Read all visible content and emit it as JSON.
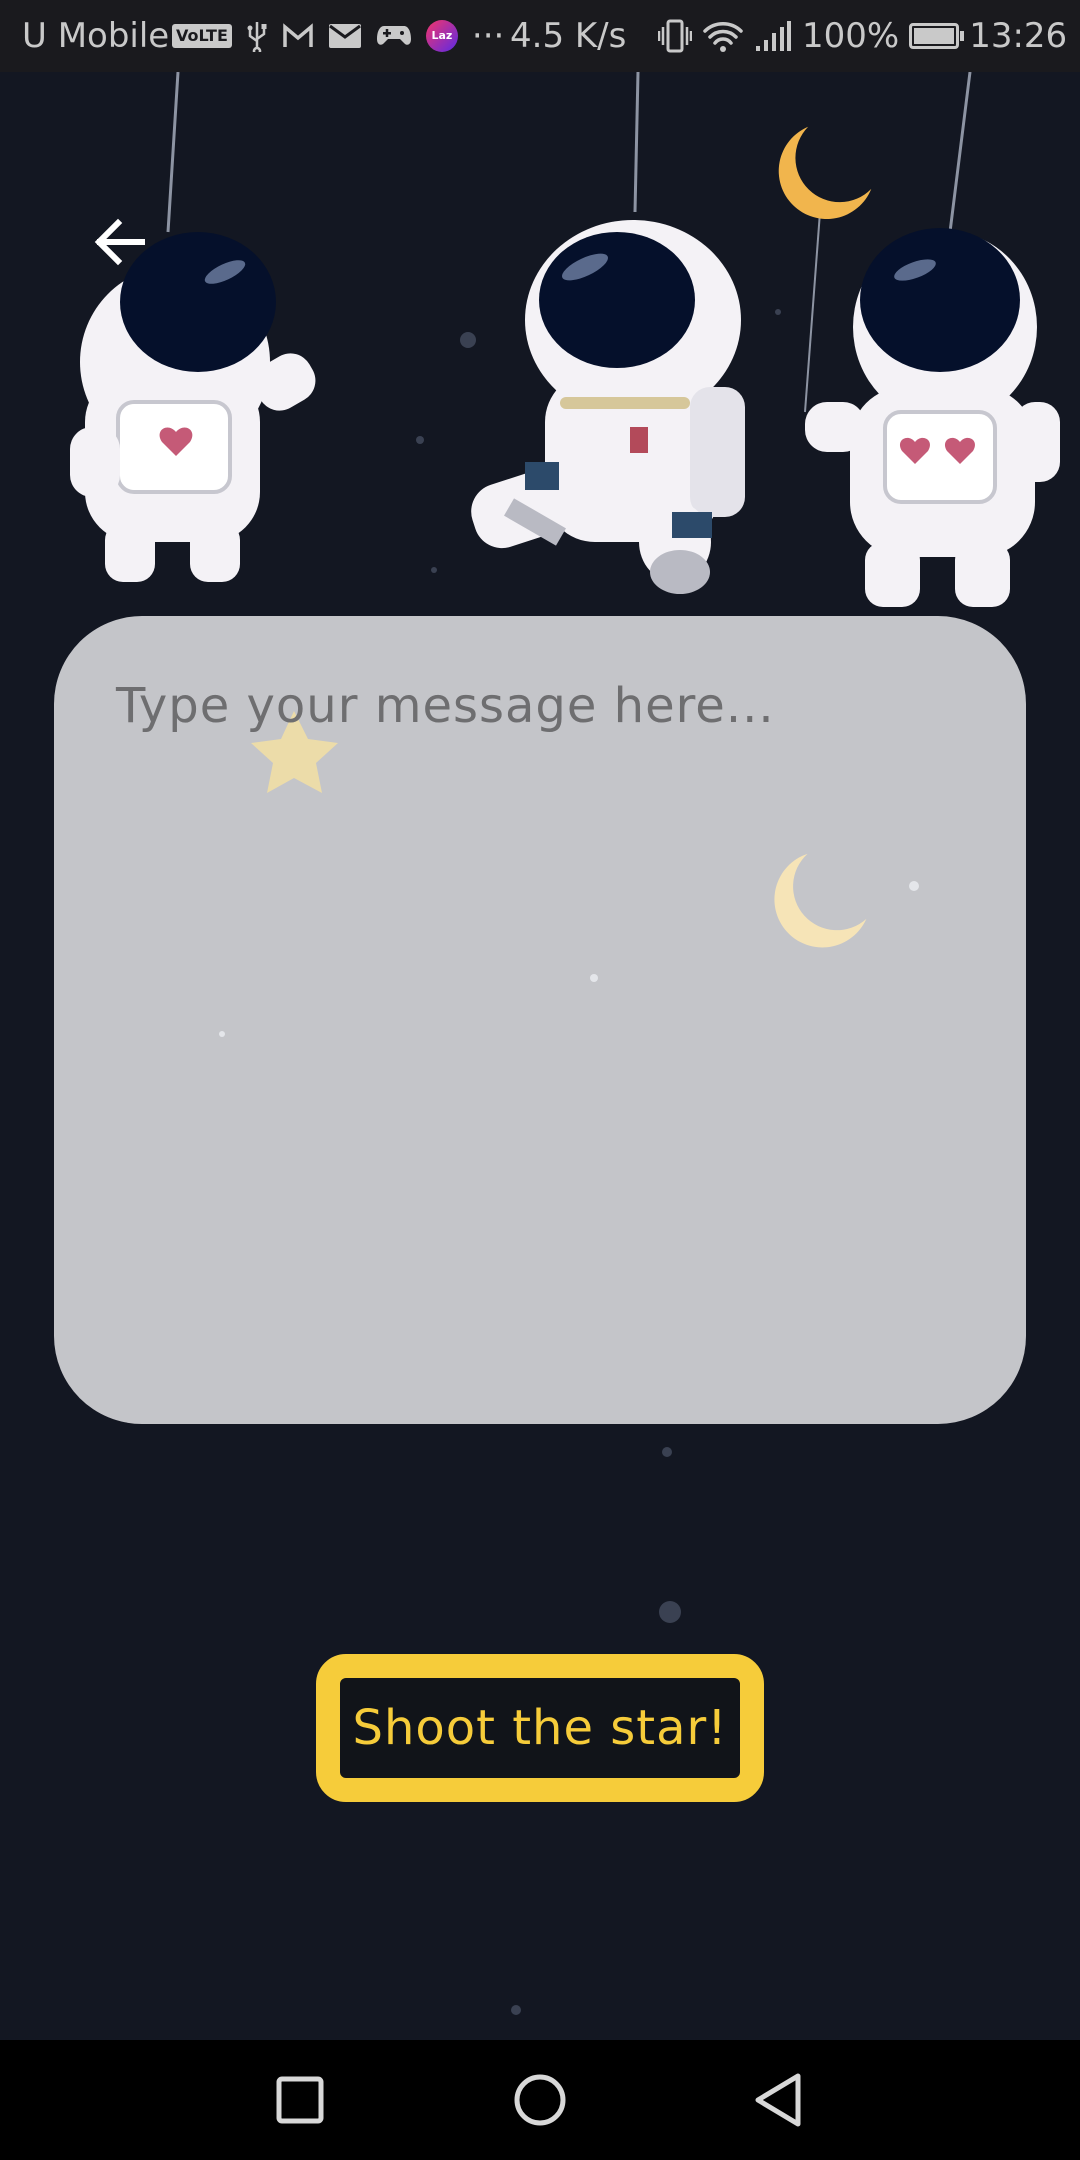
{
  "status_bar": {
    "carrier": "U Mobile",
    "volte_badge": "VoLTE",
    "lazada_badge": "Laz",
    "more_indicator": "···",
    "network_speed": "4.5 K/s",
    "battery_percent": "100%",
    "time": "13:26",
    "icons": [
      "volte-icon",
      "usb-icon",
      "gmail-icon",
      "mail-icon",
      "game-controller-icon",
      "lazada-icon",
      "vibrate-icon",
      "wifi-icon",
      "signal-icon",
      "battery-icon"
    ]
  },
  "header": {
    "back_icon": "arrow-left-icon"
  },
  "composer": {
    "placeholder": "Type your message here...",
    "value": ""
  },
  "actions": {
    "shoot_label": "Shoot the star!"
  },
  "nav": {
    "icons": [
      "square-recent-icon",
      "circle-home-icon",
      "triangle-back-icon"
    ]
  },
  "colors": {
    "background": "#131722",
    "card": "#c4c5c9",
    "accent": "#f6cc3a"
  }
}
